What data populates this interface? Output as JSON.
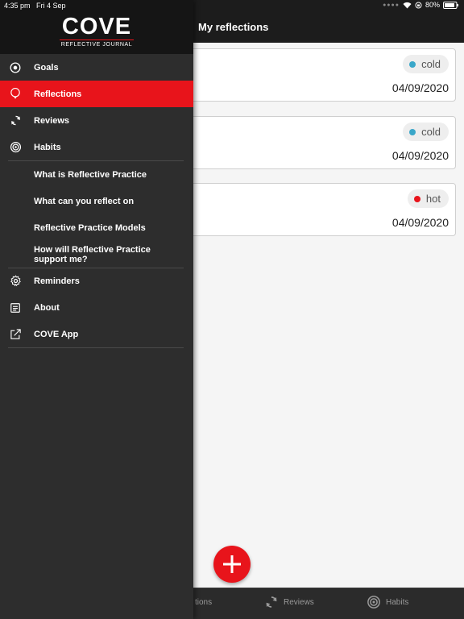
{
  "status_bar": {
    "time": "4:35 pm",
    "date": "Fri 4 Sep",
    "battery": "80%"
  },
  "header": {
    "title": "My reflections"
  },
  "reflections": [
    {
      "tag": "cold",
      "tag_color": "#3aa7c9",
      "date": "04/09/2020"
    },
    {
      "tag": "cold",
      "tag_color": "#3aa7c9",
      "date": "04/09/2020"
    },
    {
      "tag": "hot",
      "tag_color": "#e8141b",
      "date": "04/09/2020"
    }
  ],
  "tabbar": {
    "reflections_label": "tions",
    "reviews_label": "Reviews",
    "habits_label": "Habits"
  },
  "drawer": {
    "logo": "COVE",
    "logo_subtitle": "REFLECTIVE JOURNAL",
    "items": {
      "goals": "Goals",
      "reflections": "Reflections",
      "reviews": "Reviews",
      "habits": "Habits",
      "what_is": "What is Reflective Practice",
      "what_reflect": "What can you reflect on",
      "models": "Reflective Practice Models",
      "how_support": "How will Reflective Practice support me?",
      "reminders": "Reminders",
      "about": "About",
      "cove_app": "COVE App"
    }
  },
  "colors": {
    "accent": "#e8141b",
    "drawer_bg": "#2d2d2d",
    "header_bg": "#1c1c1c"
  }
}
